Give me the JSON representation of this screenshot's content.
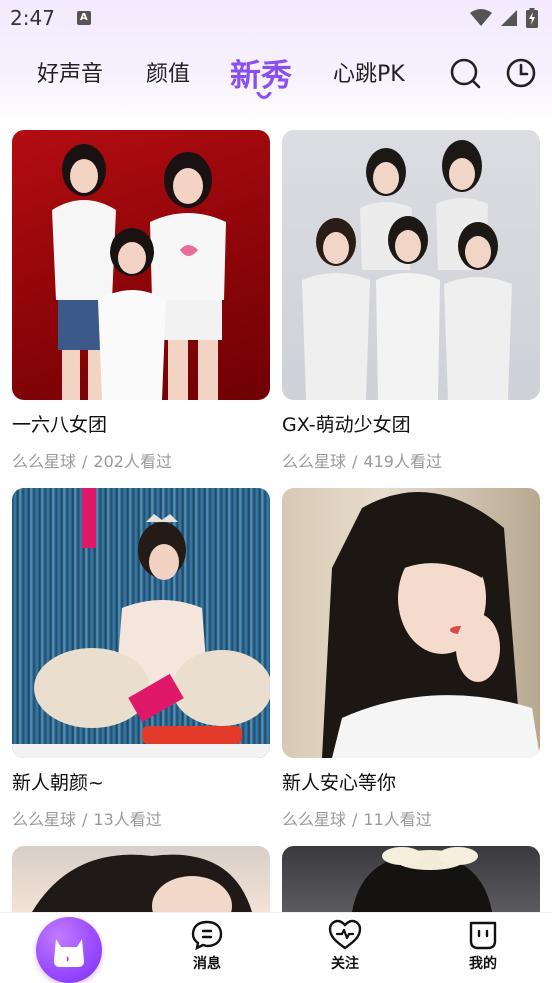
{
  "status_bar": {
    "time": "2:47",
    "notification_badge": "A",
    "icons": [
      "wifi-icon",
      "cellular-signal-icon",
      "battery-charging-icon"
    ]
  },
  "tabs": [
    {
      "label": "好声音",
      "active": false
    },
    {
      "label": "颜值",
      "active": false
    },
    {
      "label": "新秀",
      "active": true
    },
    {
      "label": "心跳PK",
      "active": false
    }
  ],
  "header_icons": [
    "search-icon",
    "history-clock-icon"
  ],
  "accent_color": "#8a4ff0",
  "cards": [
    {
      "title": "一六八女团",
      "platform": "么么星球",
      "viewers": "202人看过"
    },
    {
      "title": "GX-萌动少女团",
      "platform": "么么星球",
      "viewers": "419人看过"
    },
    {
      "title": "新人朝颜~",
      "platform": "么么星球",
      "viewers": "13人看过"
    },
    {
      "title": "新人安心等你",
      "platform": "么么星球",
      "viewers": "11人看过"
    }
  ],
  "bottom_nav": {
    "items": [
      {
        "label": "",
        "icon": "home-mascot-icon"
      },
      {
        "label": "消息",
        "icon": "message-icon"
      },
      {
        "label": "关注",
        "icon": "heart-pulse-icon"
      },
      {
        "label": "我的",
        "icon": "profile-face-icon"
      }
    ]
  }
}
